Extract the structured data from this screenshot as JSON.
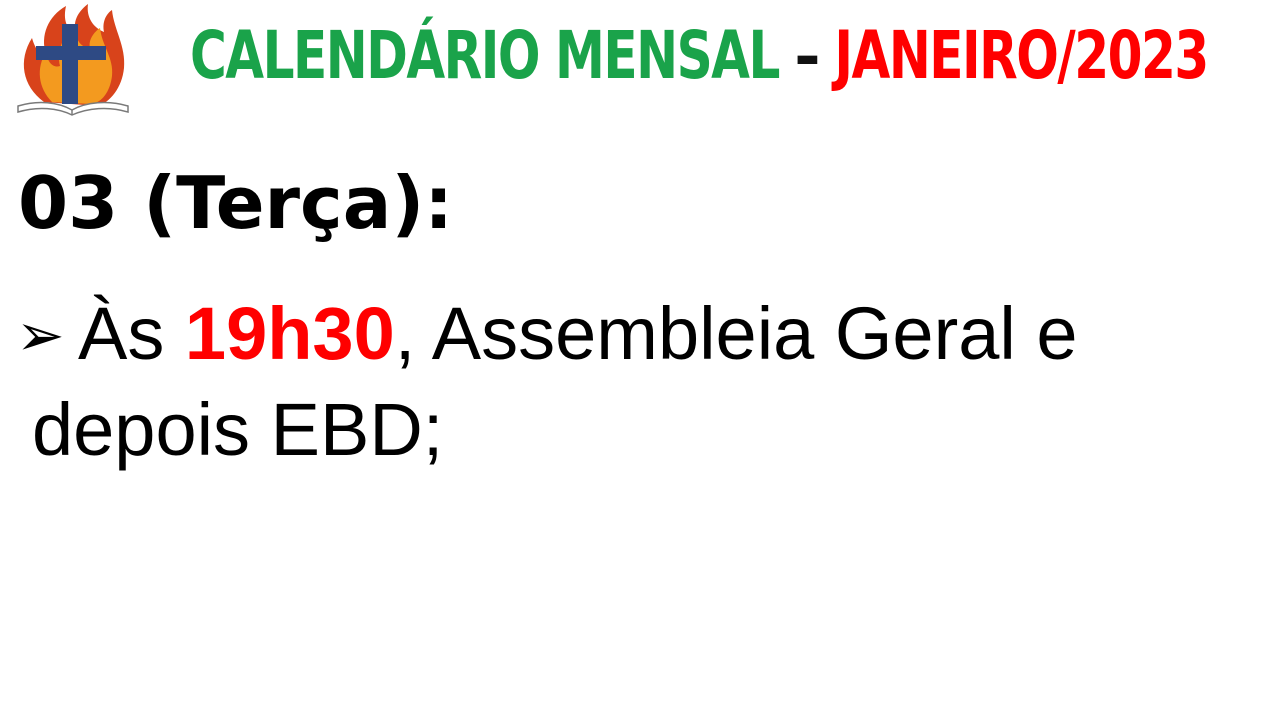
{
  "title": {
    "part_green": "CALENDÁRIO MENSAL",
    "separator": "–",
    "part_red": "JANEIRO/2023"
  },
  "logo": {
    "icon": "church-cross-flame-bible-logo",
    "colors": {
      "cross": "#2e4a84",
      "flame_outer": "#d8431b",
      "flame_inner": "#f39a1f",
      "book": "#7a7a7a"
    }
  },
  "day": {
    "heading": "03 (Terça):"
  },
  "events": [
    {
      "bullet": "➢",
      "prefix": "Às ",
      "time": "19h30",
      "text_line1": ", Assembleia Geral e",
      "text_line2": "depois EBD;"
    }
  ],
  "colors": {
    "title_green": "#1aa34a",
    "title_red": "#ff0000",
    "time_red": "#ff0000",
    "text": "#000000"
  }
}
